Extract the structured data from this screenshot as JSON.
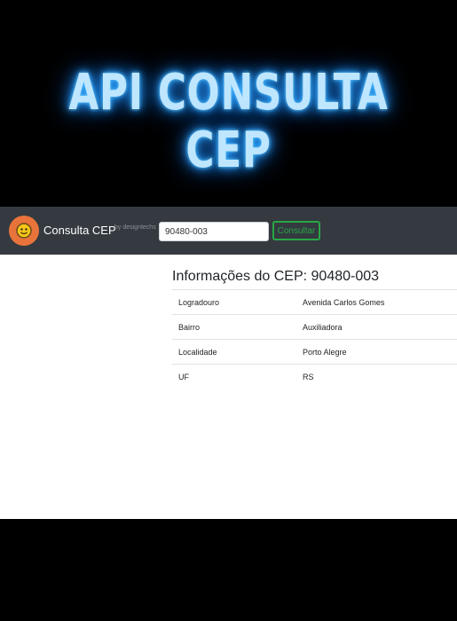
{
  "banner": {
    "title": "API CONSULTA CEP"
  },
  "navbar": {
    "brand": "Consulta CEP",
    "byline": "by designtechs",
    "search": {
      "value": "90480-003",
      "placeholder": ""
    },
    "button_label": "Consultar",
    "logo_icon": "face-emoji-icon"
  },
  "main": {
    "title": "Informações do CEP: 90480-003",
    "rows": [
      {
        "label": "Logradouro",
        "value": "Avenida Carlos Gomes"
      },
      {
        "label": "Bairro",
        "value": "Auxiliadora"
      },
      {
        "label": "Localidade",
        "value": "Porto Alegre"
      },
      {
        "label": "UF",
        "value": "RS"
      }
    ]
  },
  "colors": {
    "navbar_bg": "#343a40",
    "button_green": "#28a745",
    "neon_blue": "#2fa8ff",
    "logo_orange": "#e8743b"
  }
}
